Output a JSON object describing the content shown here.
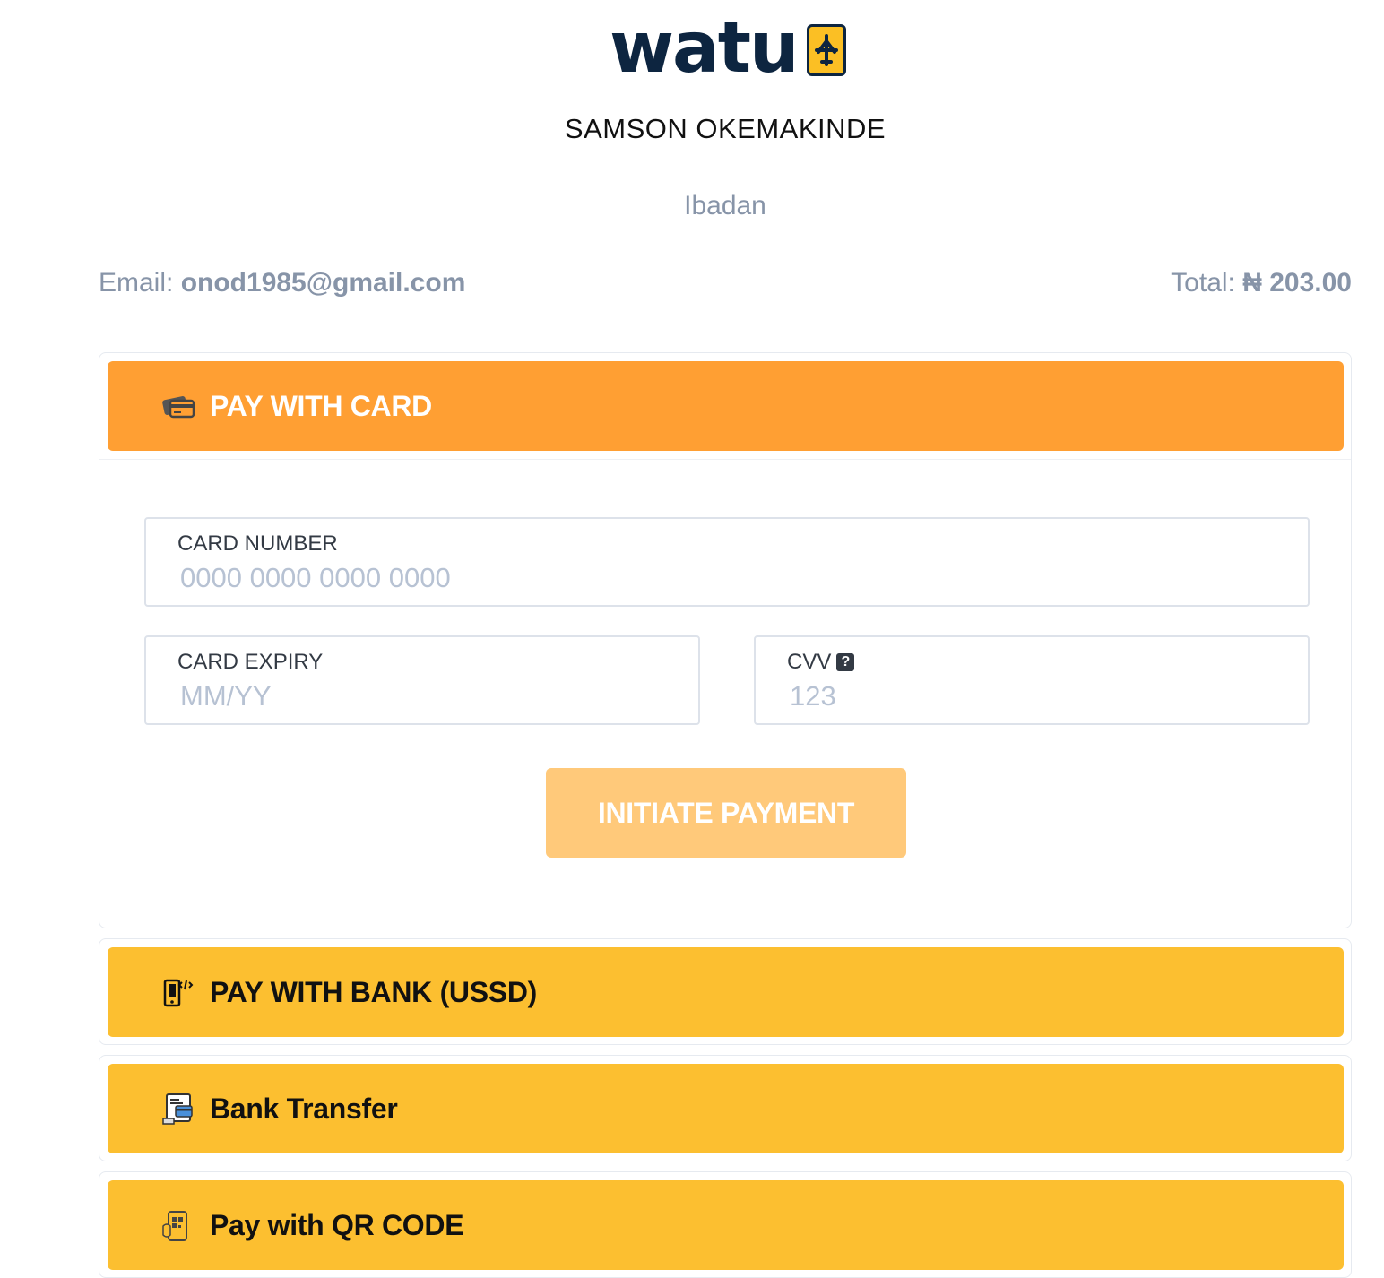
{
  "brand": {
    "logo_text": "watu",
    "logo_icon": "airplane-icon"
  },
  "merchant": {
    "name": "SAMSON OKEMAKINDE",
    "city": "Ibadan"
  },
  "summary": {
    "email_label": "Email:",
    "email_value": "onod1985@gmail.com",
    "total_label": "Total:",
    "total_value": "₦ 203.00"
  },
  "card_panel": {
    "title": "PAY WITH CARD",
    "icon": "credit-card-icon",
    "card_number": {
      "label": "CARD NUMBER",
      "placeholder": "0000 0000 0000 0000"
    },
    "card_expiry": {
      "label": "CARD EXPIRY",
      "placeholder": "MM/YY"
    },
    "cvv": {
      "label": "CVV",
      "help_icon": "question-icon",
      "placeholder": "123"
    },
    "submit_label": "INITIATE PAYMENT"
  },
  "methods": [
    {
      "label": "PAY WITH BANK (USSD)",
      "icon": "mobile-ussd-icon"
    },
    {
      "label": "Bank Transfer",
      "icon": "bank-transfer-icon"
    },
    {
      "label": "Pay with QR CODE",
      "icon": "qr-code-icon"
    }
  ],
  "colors": {
    "brand_navy": "#0d2540",
    "active_header": "#ff9f33",
    "method_header": "#fcbf30",
    "button_disabled": "#ffc97a",
    "muted_text": "#8794a8"
  }
}
